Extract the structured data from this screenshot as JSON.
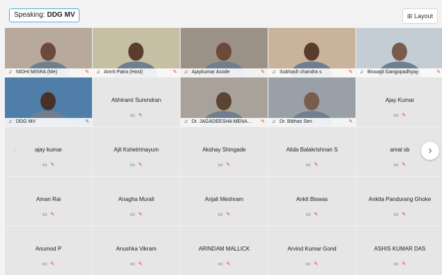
{
  "speaking": {
    "prefix": "Speaking:",
    "name": "DDG MV"
  },
  "layout_button": {
    "icon": "grid-icon",
    "label": "Layout"
  },
  "nav": {
    "prev_icon": "chevron-left-icon",
    "next_icon": "chevron-right-icon",
    "prev": "‹",
    "next": "›"
  },
  "video_tiles": [
    {
      "name": "NIDHI MISRA",
      "suffix": "(Me)",
      "bg": "#b7a99b",
      "face": "#6b4a3a"
    },
    {
      "name": "Amrit Patra",
      "suffix": "(Host)",
      "bg": "#c6bfa3",
      "face": "#5b3d2d"
    },
    {
      "name": "Ajaykumar Asode",
      "suffix": "",
      "bg": "#9c9186",
      "face": "#6a4b3a"
    },
    {
      "name": "Subhash chandra s",
      "suffix": "",
      "bg": "#c9b39b",
      "face": "#5a3c2c"
    },
    {
      "name": "Biswajit Gangopadhyay",
      "suffix": "",
      "bg": "#c4cdd4",
      "face": "#7a5a4a"
    },
    {
      "name": "DDG MV",
      "suffix": "",
      "bg": "#4f7fa8",
      "face": "#4a3128"
    },
    {
      "name": "Dr. JAGADEESHA MENA...",
      "suffix": "",
      "bg": "#a8a29a",
      "face": "#5d4332"
    },
    {
      "name": "Dr. Bibhas Sen",
      "suffix": "",
      "bg": "#9aa0a8",
      "face": "#7a5c4c"
    }
  ],
  "name_tiles": [
    {
      "name": "Abhirami Surendran",
      "mic": "mic-off"
    },
    {
      "name": "Ajay Kumar",
      "mic": "mic-off"
    },
    {
      "name": "ajay kumar",
      "mic": "mic-off"
    },
    {
      "name": "Ajit Kshetrimayum",
      "mic": "mic-off"
    },
    {
      "name": "Akshay Shingade",
      "mic": "mic-off"
    },
    {
      "name": "Alida Balakrishnan S",
      "mic": "mic-off"
    },
    {
      "name": "amal sb",
      "mic": "mic-off"
    },
    {
      "name": "Aman Rai",
      "mic": "mic-off"
    },
    {
      "name": "Anagha Murali",
      "mic": "mic-off"
    },
    {
      "name": "Anjali Meshram",
      "mic": "mic-off"
    },
    {
      "name": "Ankit Biswas",
      "mic": "mic-off"
    },
    {
      "name": "Ankita Pandurang Ghoke",
      "mic": "mic-off"
    },
    {
      "name": "Anumod P",
      "mic": "mic-off"
    },
    {
      "name": "Anushka Vikram",
      "mic": "mic-off"
    },
    {
      "name": "ARINDAM MALLICK",
      "mic": "mic-off"
    },
    {
      "name": "Arvind Kumar Gond",
      "mic": "mic-off"
    },
    {
      "name": "ASHIS KUMAR DAS",
      "mic": "mic-off"
    }
  ]
}
